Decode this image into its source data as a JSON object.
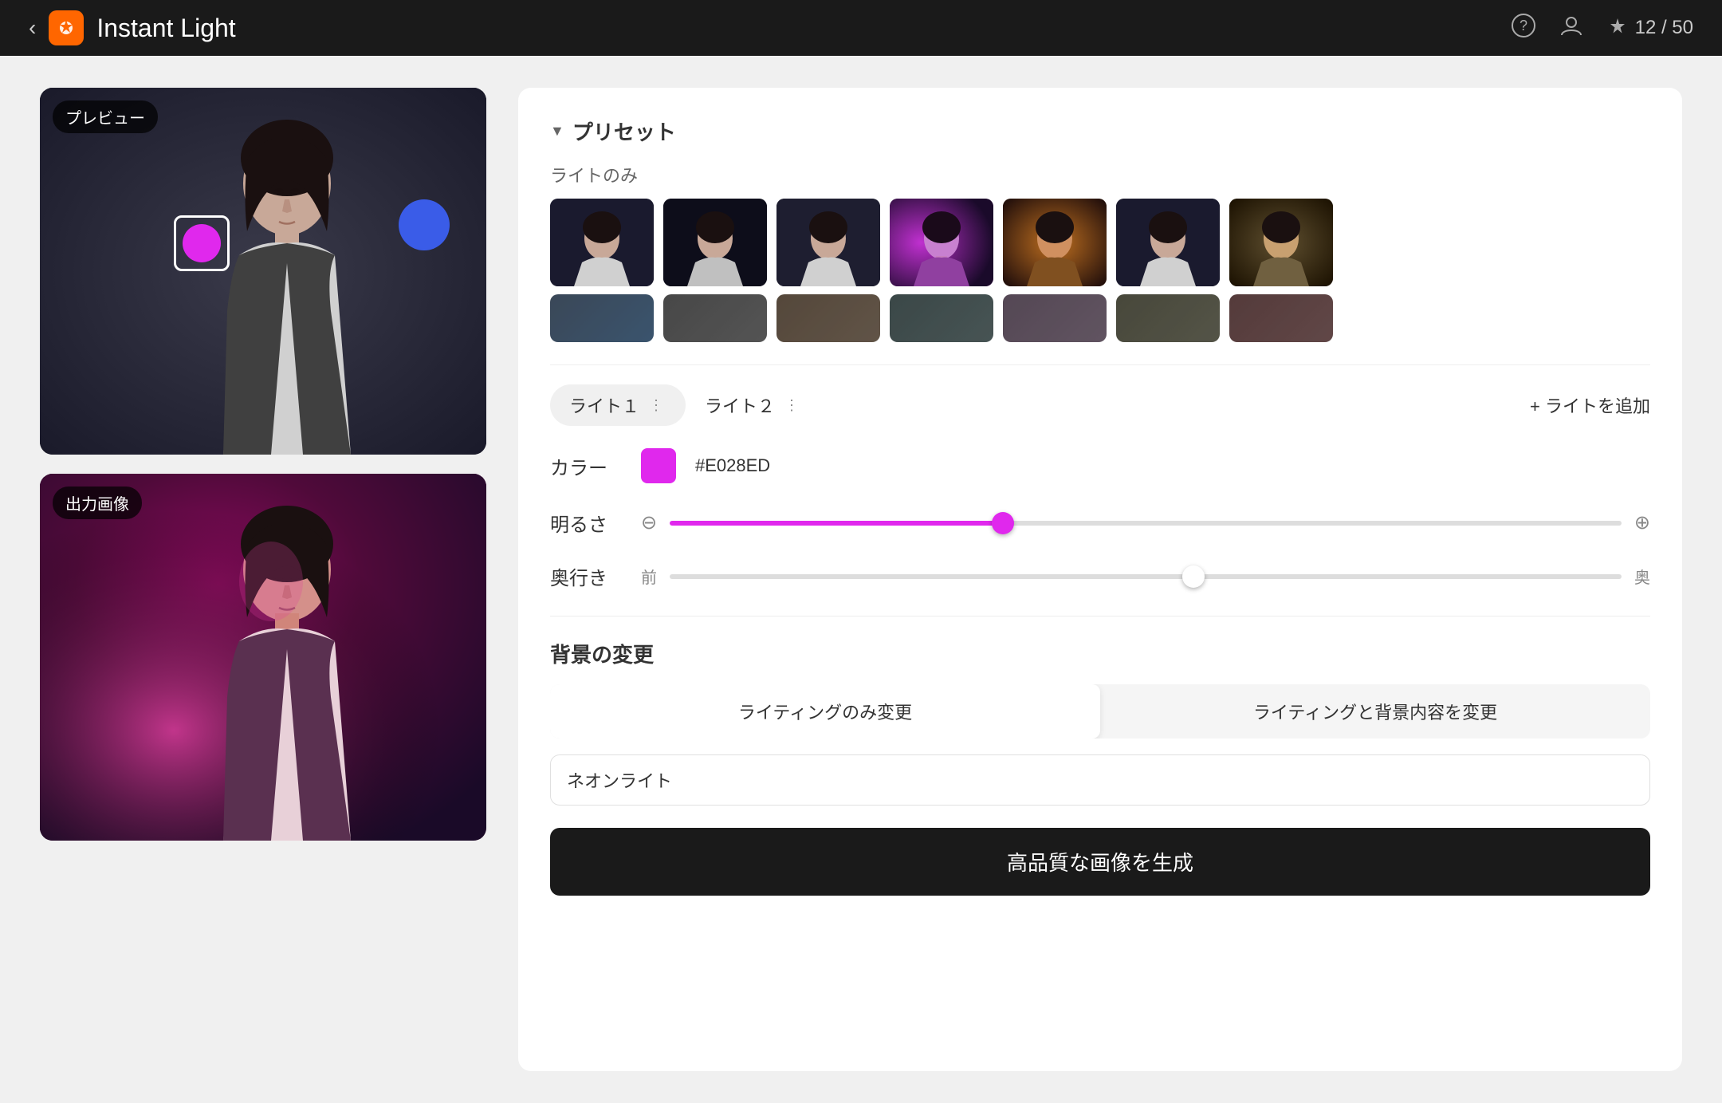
{
  "header": {
    "back_label": "‹",
    "app_title": "Instant Light",
    "help_icon": "?",
    "user_icon": "👤",
    "credits_icon": "⚡",
    "credits_text": "12 / 50"
  },
  "left_panel": {
    "preview_label": "プレビュー",
    "output_label": "出力画像"
  },
  "right_panel": {
    "preset_section": {
      "collapse_icon": "▼",
      "title": "プリセット",
      "category": "ライトのみ",
      "thumbnails_row1": [
        "preset-1",
        "preset-2",
        "preset-3",
        "preset-4",
        "preset-5",
        "preset-6",
        "preset-7"
      ],
      "thumbnails_row2": [
        "preset-8",
        "preset-9",
        "preset-10",
        "preset-11",
        "preset-12",
        "preset-13",
        "preset-14"
      ]
    },
    "tabs": {
      "tab1_label": "ライト１",
      "tab1_menu": "⋮",
      "tab2_label": "ライト２",
      "tab2_menu": "⋮",
      "add_light_label": "+ ライトを追加"
    },
    "color_control": {
      "label": "カラー",
      "color_value": "#E028ED",
      "color_hex_display": "#E028ED"
    },
    "brightness_control": {
      "label": "明るさ",
      "minus_icon": "⊖",
      "plus_icon": "⊕",
      "value": 35
    },
    "depth_control": {
      "label": "奥行き",
      "front_label": "前",
      "back_label": "奥",
      "value": 55
    },
    "bg_section": {
      "title": "背景の変更",
      "btn_lighting_only": "ライティングのみ変更",
      "btn_lighting_bg": "ライティングと背景内容を変更",
      "description_placeholder": "ネオンライト",
      "generate_btn_label": "高品質な画像を生成"
    }
  }
}
